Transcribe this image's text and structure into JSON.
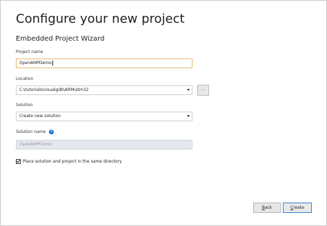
{
  "header": {
    "title": "Configure your new project",
    "subtitle": "Embedded Project Wizard"
  },
  "form": {
    "project_name": {
      "label": "Project name",
      "value": "OpenAMPDemo"
    },
    "location": {
      "label": "Location",
      "value": "C:\\tutorials\\visualgdb\\ARM\\stm32",
      "browse_label": "..."
    },
    "solution": {
      "label": "Solution",
      "value": "Create new solution"
    },
    "solution_name": {
      "label": "Solution name",
      "value": "OpenAMPDemo",
      "info_glyph": "i"
    },
    "same_directory": {
      "label": "Place solution and project in the same directory",
      "checked": true
    }
  },
  "footer": {
    "back_label": "Back",
    "create_label": "Create"
  },
  "colors": {
    "focus_border": "#e3b96a",
    "info_icon": "#1a73c8",
    "primary_border": "#3b7fd4",
    "disabled_field": "#e4e7ed"
  },
  "icons": {
    "info": "info-icon",
    "dropdown": "chevron-down-icon",
    "checkbox": "checkmark-icon"
  }
}
